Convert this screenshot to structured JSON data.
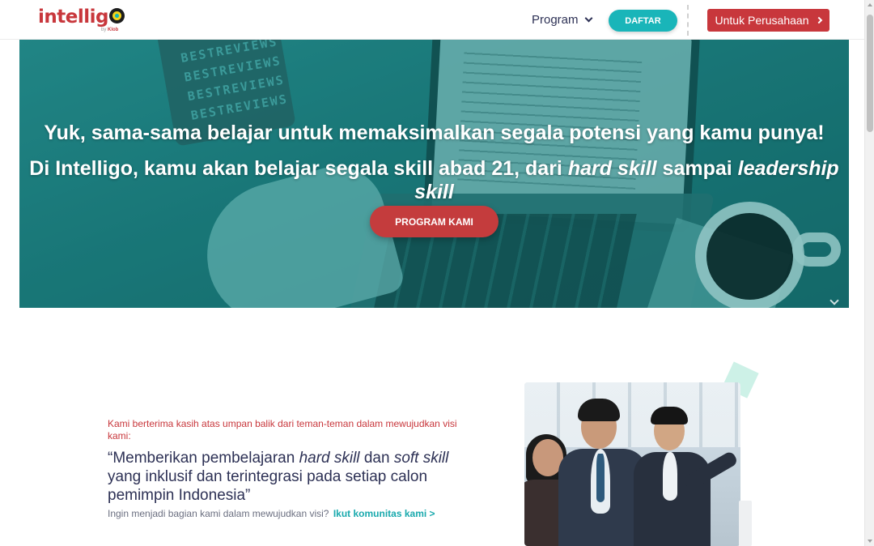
{
  "header": {
    "logo_text": "intellig",
    "logo_by": "by",
    "logo_brand": "Klob",
    "nav_program": "Program",
    "daftar": "DAFTAR",
    "perusahaan": "Untuk Perusahaan"
  },
  "hero": {
    "line1": "Yuk, sama-sama belajar untuk memaksimalkan segala potensi yang kamu punya!",
    "line2_a": "Di Intelligo, kamu akan belajar segala skill abad 21, dari ",
    "line2_b": "hard skill",
    "line2_c": " sampai ",
    "line2_d": "leadership skill",
    "cta": "PROGRAM KAMI",
    "tablet_text": [
      "BESTREVIEWS",
      "BESTREVIEWS",
      "BESTREVIEWS",
      "BESTREVIEWS"
    ]
  },
  "mission": {
    "thanks": "Kami berterima kasih atas umpan balik dari teman-teman dalam mewujudkan visi kami:",
    "quote_a": "“Memberikan pembelajaran ",
    "quote_b": "hard skill",
    "quote_c": " dan ",
    "quote_d": "soft skill",
    "quote_e": " yang inklusif dan terintegrasi pada setiap calon pemimpin Indonesia”",
    "visi_text": "Ingin menjadi bagian kami dalam mewujudkan visi?",
    "visi_link": "Ikut komunitas kami >"
  },
  "colors": {
    "brand_red": "#c8373c",
    "brand_teal": "#19b5b9",
    "navy": "#2d3155"
  }
}
